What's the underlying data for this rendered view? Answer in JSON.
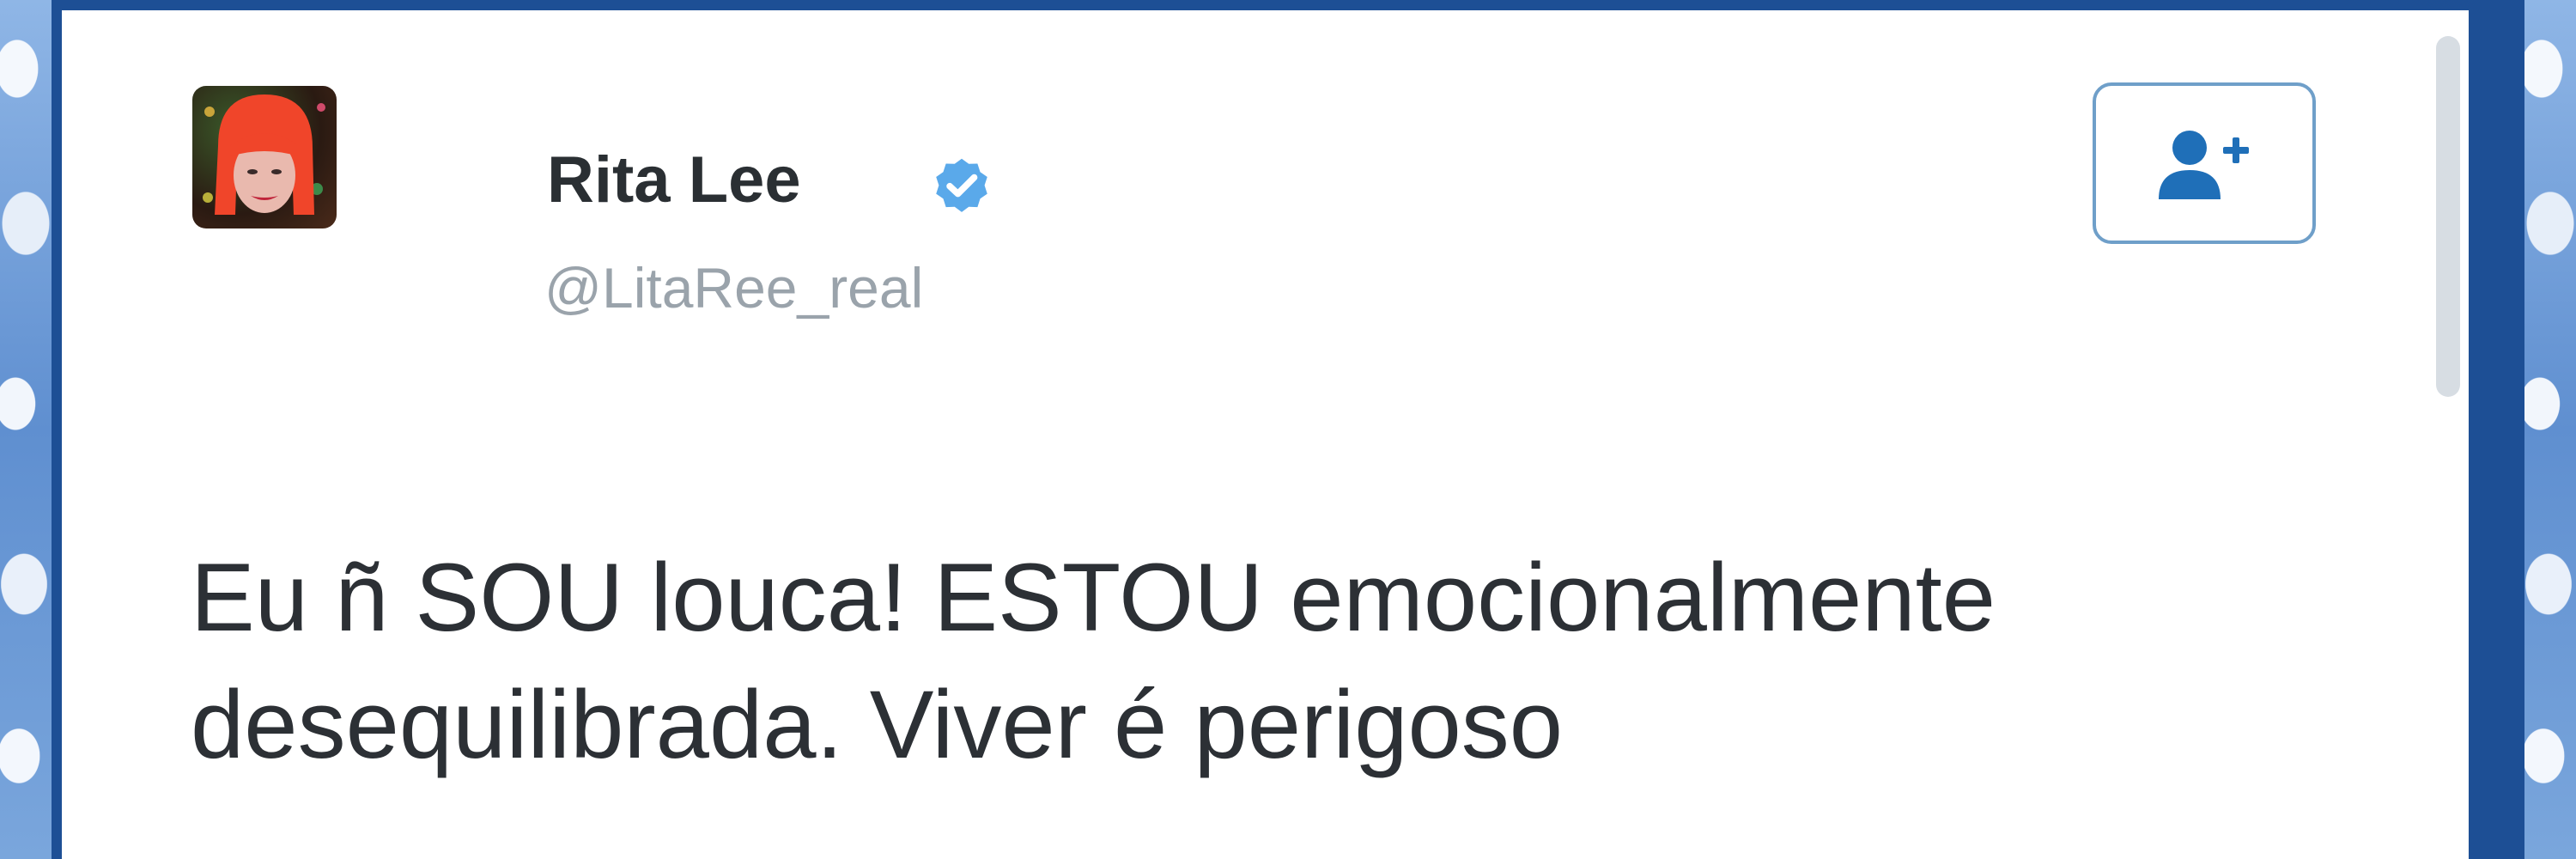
{
  "tweet": {
    "user": {
      "name": "Rita Lee",
      "handle": "@LitaRee_real",
      "verified": true,
      "avatar_icon": "user-avatar-photo"
    },
    "follow_button": {
      "icon": "add-user-icon"
    },
    "text_lines": [
      "Eu ñ SOU louca! ESTOU emocionalmente",
      "desequilibrada. Viver é perigoso"
    ]
  },
  "colors": {
    "background_blue": "#1d4f95",
    "verified_blue": "#5aa9ea",
    "follow_border": "#6f9fc9",
    "follow_icon": "#1f6fb8",
    "name_text": "#2a2f33",
    "handle_text": "#9aa3ab",
    "body_text": "#2c3035"
  }
}
